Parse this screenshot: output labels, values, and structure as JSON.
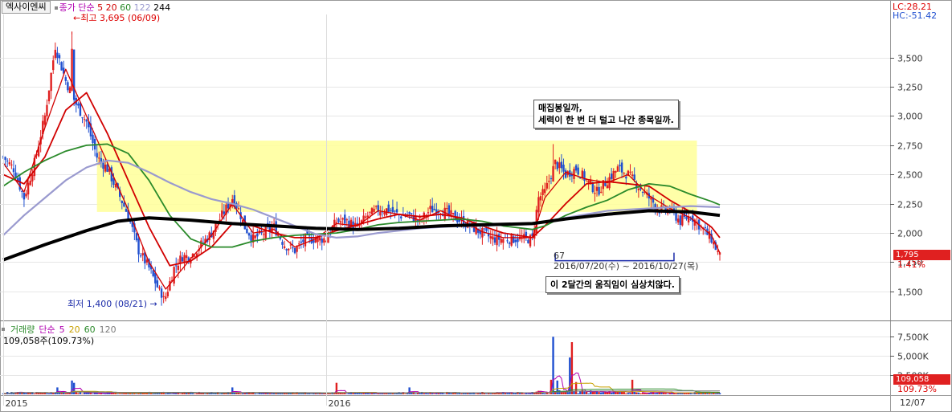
{
  "stock_name": "엑사이엔씨",
  "price_legend": {
    "label": "종가 단순",
    "ma_periods": [
      "5",
      "20",
      "60",
      "122",
      "244"
    ],
    "ma_colors": [
      "#d10000",
      "#d10000",
      "#2a8a2a",
      "#9a9acf",
      "#000000"
    ]
  },
  "indicator_top": {
    "lc": "LC:28.21",
    "hc": "HC:-51.42"
  },
  "annotations": {
    "high_label": "최고 3,695 (06/09)",
    "low_label": "최저 1,400 (08/21)",
    "count_label": "67",
    "range_label": "2016/07/20(수) ~ 2016/10/27(목)",
    "callout_top": "매집봉일까,\n세력이 한 번 더 털고 나간 종목일까.",
    "callout_bottom": "이 2달간의 움직임이 심상치않다."
  },
  "price_tag": {
    "value": "1,795",
    "change": "1.41%"
  },
  "volume_legend": {
    "label": "거래량",
    "ma_label": "단순",
    "ma_periods": [
      "5",
      "20",
      "60",
      "120"
    ],
    "ma_colors": [
      "#b000b0",
      "#c8a000",
      "#2a8a2a",
      "#7a7a7a"
    ],
    "current": "109,058주(109.73%)"
  },
  "volume_tag": {
    "value": "109,058",
    "change": "109.73%"
  },
  "x_axis": {
    "labels": [
      "2015",
      "2016"
    ],
    "last_date": "12/07"
  },
  "colors": {
    "up": "#e02020",
    "down": "#2050d0",
    "highlight": "#ffff99",
    "range_bracket": "#1a2aa8",
    "grid": "#e6e6e6"
  },
  "chart_data": {
    "type": "candlestick",
    "price": {
      "ylim": [
        1300,
        3800
      ],
      "yticks": [
        1500,
        1750,
        2000,
        2250,
        2500,
        2750,
        3000,
        3250,
        3500
      ],
      "ytick_labels": [
        "1,500",
        "1,750",
        "2,000",
        "2,250",
        "2,500",
        "2,750",
        "3,000",
        "3,250",
        "3,500"
      ],
      "close_path": [
        [
          0,
          2650
        ],
        [
          5,
          2550
        ],
        [
          10,
          2300
        ],
        [
          15,
          2600
        ],
        [
          20,
          3000
        ],
        [
          25,
          3600
        ],
        [
          30,
          3300
        ],
        [
          35,
          3100
        ],
        [
          40,
          2950
        ],
        [
          45,
          2650
        ],
        [
          50,
          2550
        ],
        [
          55,
          2350
        ],
        [
          60,
          2150
        ],
        [
          65,
          1850
        ],
        [
          70,
          1700
        ],
        [
          75,
          1500
        ],
        [
          78,
          1460
        ],
        [
          82,
          1700
        ],
        [
          86,
          1800
        ],
        [
          90,
          1800
        ],
        [
          95,
          1900
        ],
        [
          100,
          2000
        ],
        [
          105,
          2150
        ],
        [
          110,
          2300
        ],
        [
          113,
          2200
        ],
        [
          116,
          2050
        ],
        [
          120,
          1950
        ],
        [
          125,
          2000
        ],
        [
          130,
          2050
        ],
        [
          135,
          1900
        ],
        [
          140,
          1850
        ],
        [
          145,
          1950
        ],
        [
          150,
          1950
        ],
        [
          155,
          1950
        ],
        [
          160,
          2100
        ],
        [
          165,
          2100
        ],
        [
          170,
          2050
        ],
        [
          175,
          2150
        ],
        [
          180,
          2200
        ],
        [
          185,
          2200
        ],
        [
          190,
          2150
        ],
        [
          195,
          2150
        ],
        [
          200,
          2100
        ],
        [
          205,
          2200
        ],
        [
          210,
          2200
        ],
        [
          215,
          2150
        ],
        [
          220,
          2100
        ],
        [
          225,
          2050
        ],
        [
          230,
          2000
        ],
        [
          235,
          1950
        ],
        [
          240,
          1950
        ],
        [
          245,
          1950
        ],
        [
          250,
          1950
        ],
        [
          254,
          1950
        ],
        [
          257,
          2300
        ],
        [
          260,
          2350
        ],
        [
          265,
          2600
        ],
        [
          270,
          2500
        ],
        [
          275,
          2550
        ],
        [
          280,
          2450
        ],
        [
          285,
          2350
        ],
        [
          290,
          2450
        ],
        [
          295,
          2550
        ],
        [
          300,
          2500
        ],
        [
          305,
          2400
        ],
        [
          310,
          2300
        ],
        [
          315,
          2200
        ],
        [
          320,
          2200
        ],
        [
          325,
          2100
        ],
        [
          330,
          2150
        ],
        [
          335,
          2050
        ],
        [
          340,
          1950
        ],
        [
          344,
          1795
        ]
      ],
      "ma_paths": [
        {
          "period": "5",
          "points": [
            [
              0,
              2600
            ],
            [
              10,
              2350
            ],
            [
              20,
              2900
            ],
            [
              30,
              3400
            ],
            [
              40,
              3000
            ],
            [
              50,
              2600
            ],
            [
              60,
              2200
            ],
            [
              70,
              1750
            ],
            [
              78,
              1520
            ],
            [
              90,
              1780
            ],
            [
              100,
              1980
            ],
            [
              110,
              2250
            ],
            [
              120,
              2000
            ],
            [
              130,
              2030
            ],
            [
              140,
              1880
            ],
            [
              150,
              1950
            ],
            [
              160,
              2080
            ],
            [
              170,
              2060
            ],
            [
              180,
              2190
            ],
            [
              190,
              2160
            ],
            [
              200,
              2110
            ],
            [
              210,
              2190
            ],
            [
              220,
              2110
            ],
            [
              230,
              2010
            ],
            [
              240,
              1960
            ],
            [
              254,
              1960
            ],
            [
              260,
              2300
            ],
            [
              270,
              2520
            ],
            [
              280,
              2460
            ],
            [
              290,
              2430
            ],
            [
              300,
              2500
            ],
            [
              310,
              2320
            ],
            [
              320,
              2210
            ],
            [
              330,
              2130
            ],
            [
              340,
              1980
            ],
            [
              344,
              1830
            ]
          ]
        },
        {
          "period": "20",
          "points": [
            [
              0,
              2500
            ],
            [
              10,
              2420
            ],
            [
              20,
              2650
            ],
            [
              30,
              3050
            ],
            [
              40,
              3200
            ],
            [
              50,
              2850
            ],
            [
              60,
              2450
            ],
            [
              70,
              2050
            ],
            [
              80,
              1720
            ],
            [
              90,
              1760
            ],
            [
              100,
              1880
            ],
            [
              110,
              2080
            ],
            [
              120,
              2060
            ],
            [
              130,
              2000
            ],
            [
              140,
              1960
            ],
            [
              150,
              1960
            ],
            [
              160,
              2020
            ],
            [
              170,
              2070
            ],
            [
              180,
              2120
            ],
            [
              190,
              2160
            ],
            [
              200,
              2140
            ],
            [
              210,
              2160
            ],
            [
              220,
              2130
            ],
            [
              230,
              2060
            ],
            [
              240,
              2000
            ],
            [
              254,
              1960
            ],
            [
              260,
              2060
            ],
            [
              270,
              2250
            ],
            [
              280,
              2420
            ],
            [
              290,
              2440
            ],
            [
              300,
              2420
            ],
            [
              310,
              2400
            ],
            [
              320,
              2280
            ],
            [
              330,
              2180
            ],
            [
              340,
              2050
            ],
            [
              344,
              1960
            ]
          ]
        },
        {
          "period": "60",
          "points": [
            [
              0,
              2400
            ],
            [
              10,
              2520
            ],
            [
              20,
              2620
            ],
            [
              30,
              2700
            ],
            [
              40,
              2750
            ],
            [
              50,
              2760
            ],
            [
              60,
              2680
            ],
            [
              70,
              2450
            ],
            [
              80,
              2150
            ],
            [
              90,
              1950
            ],
            [
              100,
              1880
            ],
            [
              110,
              1880
            ],
            [
              120,
              1930
            ],
            [
              130,
              1960
            ],
            [
              140,
              1980
            ],
            [
              150,
              1990
            ],
            [
              160,
              2000
            ],
            [
              170,
              2030
            ],
            [
              180,
              2070
            ],
            [
              190,
              2090
            ],
            [
              200,
              2100
            ],
            [
              210,
              2110
            ],
            [
              220,
              2120
            ],
            [
              230,
              2100
            ],
            [
              240,
              2060
            ],
            [
              254,
              2030
            ],
            [
              260,
              2060
            ],
            [
              270,
              2150
            ],
            [
              280,
              2220
            ],
            [
              290,
              2280
            ],
            [
              300,
              2370
            ],
            [
              310,
              2420
            ],
            [
              320,
              2400
            ],
            [
              330,
              2330
            ],
            [
              340,
              2270
            ],
            [
              344,
              2240
            ]
          ]
        },
        {
          "period": "122",
          "points": [
            [
              0,
              1980
            ],
            [
              10,
              2150
            ],
            [
              20,
              2300
            ],
            [
              30,
              2450
            ],
            [
              40,
              2560
            ],
            [
              50,
              2620
            ],
            [
              60,
              2600
            ],
            [
              70,
              2520
            ],
            [
              80,
              2430
            ],
            [
              90,
              2350
            ],
            [
              100,
              2290
            ],
            [
              110,
              2250
            ],
            [
              120,
              2200
            ],
            [
              130,
              2130
            ],
            [
              140,
              2060
            ],
            [
              150,
              1990
            ],
            [
              160,
              1960
            ],
            [
              170,
              1970
            ],
            [
              180,
              2000
            ],
            [
              190,
              2020
            ],
            [
              200,
              2040
            ],
            [
              210,
              2050
            ],
            [
              220,
              2060
            ],
            [
              230,
              2060
            ],
            [
              240,
              2070
            ],
            [
              254,
              2080
            ],
            [
              270,
              2130
            ],
            [
              290,
              2190
            ],
            [
              310,
              2210
            ],
            [
              330,
              2230
            ],
            [
              344,
              2220
            ]
          ]
        },
        {
          "period": "244",
          "points": [
            [
              0,
              1770
            ],
            [
              20,
              1900
            ],
            [
              40,
              2020
            ],
            [
              55,
              2100
            ],
            [
              70,
              2130
            ],
            [
              90,
              2110
            ],
            [
              110,
              2080
            ],
            [
              130,
              2060
            ],
            [
              150,
              2040
            ],
            [
              170,
              2030
            ],
            [
              190,
              2040
            ],
            [
              210,
              2060
            ],
            [
              230,
              2070
            ],
            [
              254,
              2080
            ],
            [
              270,
              2120
            ],
            [
              290,
              2160
            ],
            [
              310,
              2190
            ],
            [
              330,
              2180
            ],
            [
              344,
              2150
            ]
          ]
        }
      ],
      "highlight_box": {
        "x_range": [
          45,
          333
        ],
        "y_range": [
          2180,
          2790
        ]
      },
      "high": {
        "x": 33,
        "value": 3695
      },
      "low": {
        "x": 77,
        "value": 1400
      },
      "range_bracket": {
        "x_range": [
          265,
          322
        ],
        "value": 1900
      }
    },
    "volume": {
      "ylim": [
        0,
        9000
      ],
      "yticks": [
        2500,
        5000,
        7500
      ],
      "ytick_labels": [
        "2,500K",
        "5,000K",
        "7,500K"
      ],
      "unit": "K",
      "spikes": [
        {
          "x": 33,
          "value": 1800
        },
        {
          "x": 34,
          "value": 1500
        },
        {
          "x": 26,
          "value": 900
        },
        {
          "x": 110,
          "value": 900
        },
        {
          "x": 160,
          "value": 1500
        },
        {
          "x": 195,
          "value": 900
        },
        {
          "x": 263,
          "value": 1900
        },
        {
          "x": 264,
          "value": 7500
        },
        {
          "x": 266,
          "value": 1800
        },
        {
          "x": 272,
          "value": 4800
        },
        {
          "x": 273,
          "value": 6800
        },
        {
          "x": 275,
          "value": 1600
        },
        {
          "x": 302,
          "value": 1900
        }
      ]
    },
    "x_ticks": [
      {
        "x": 0,
        "label": "2015"
      },
      {
        "x": 155,
        "label": "2016"
      }
    ]
  }
}
